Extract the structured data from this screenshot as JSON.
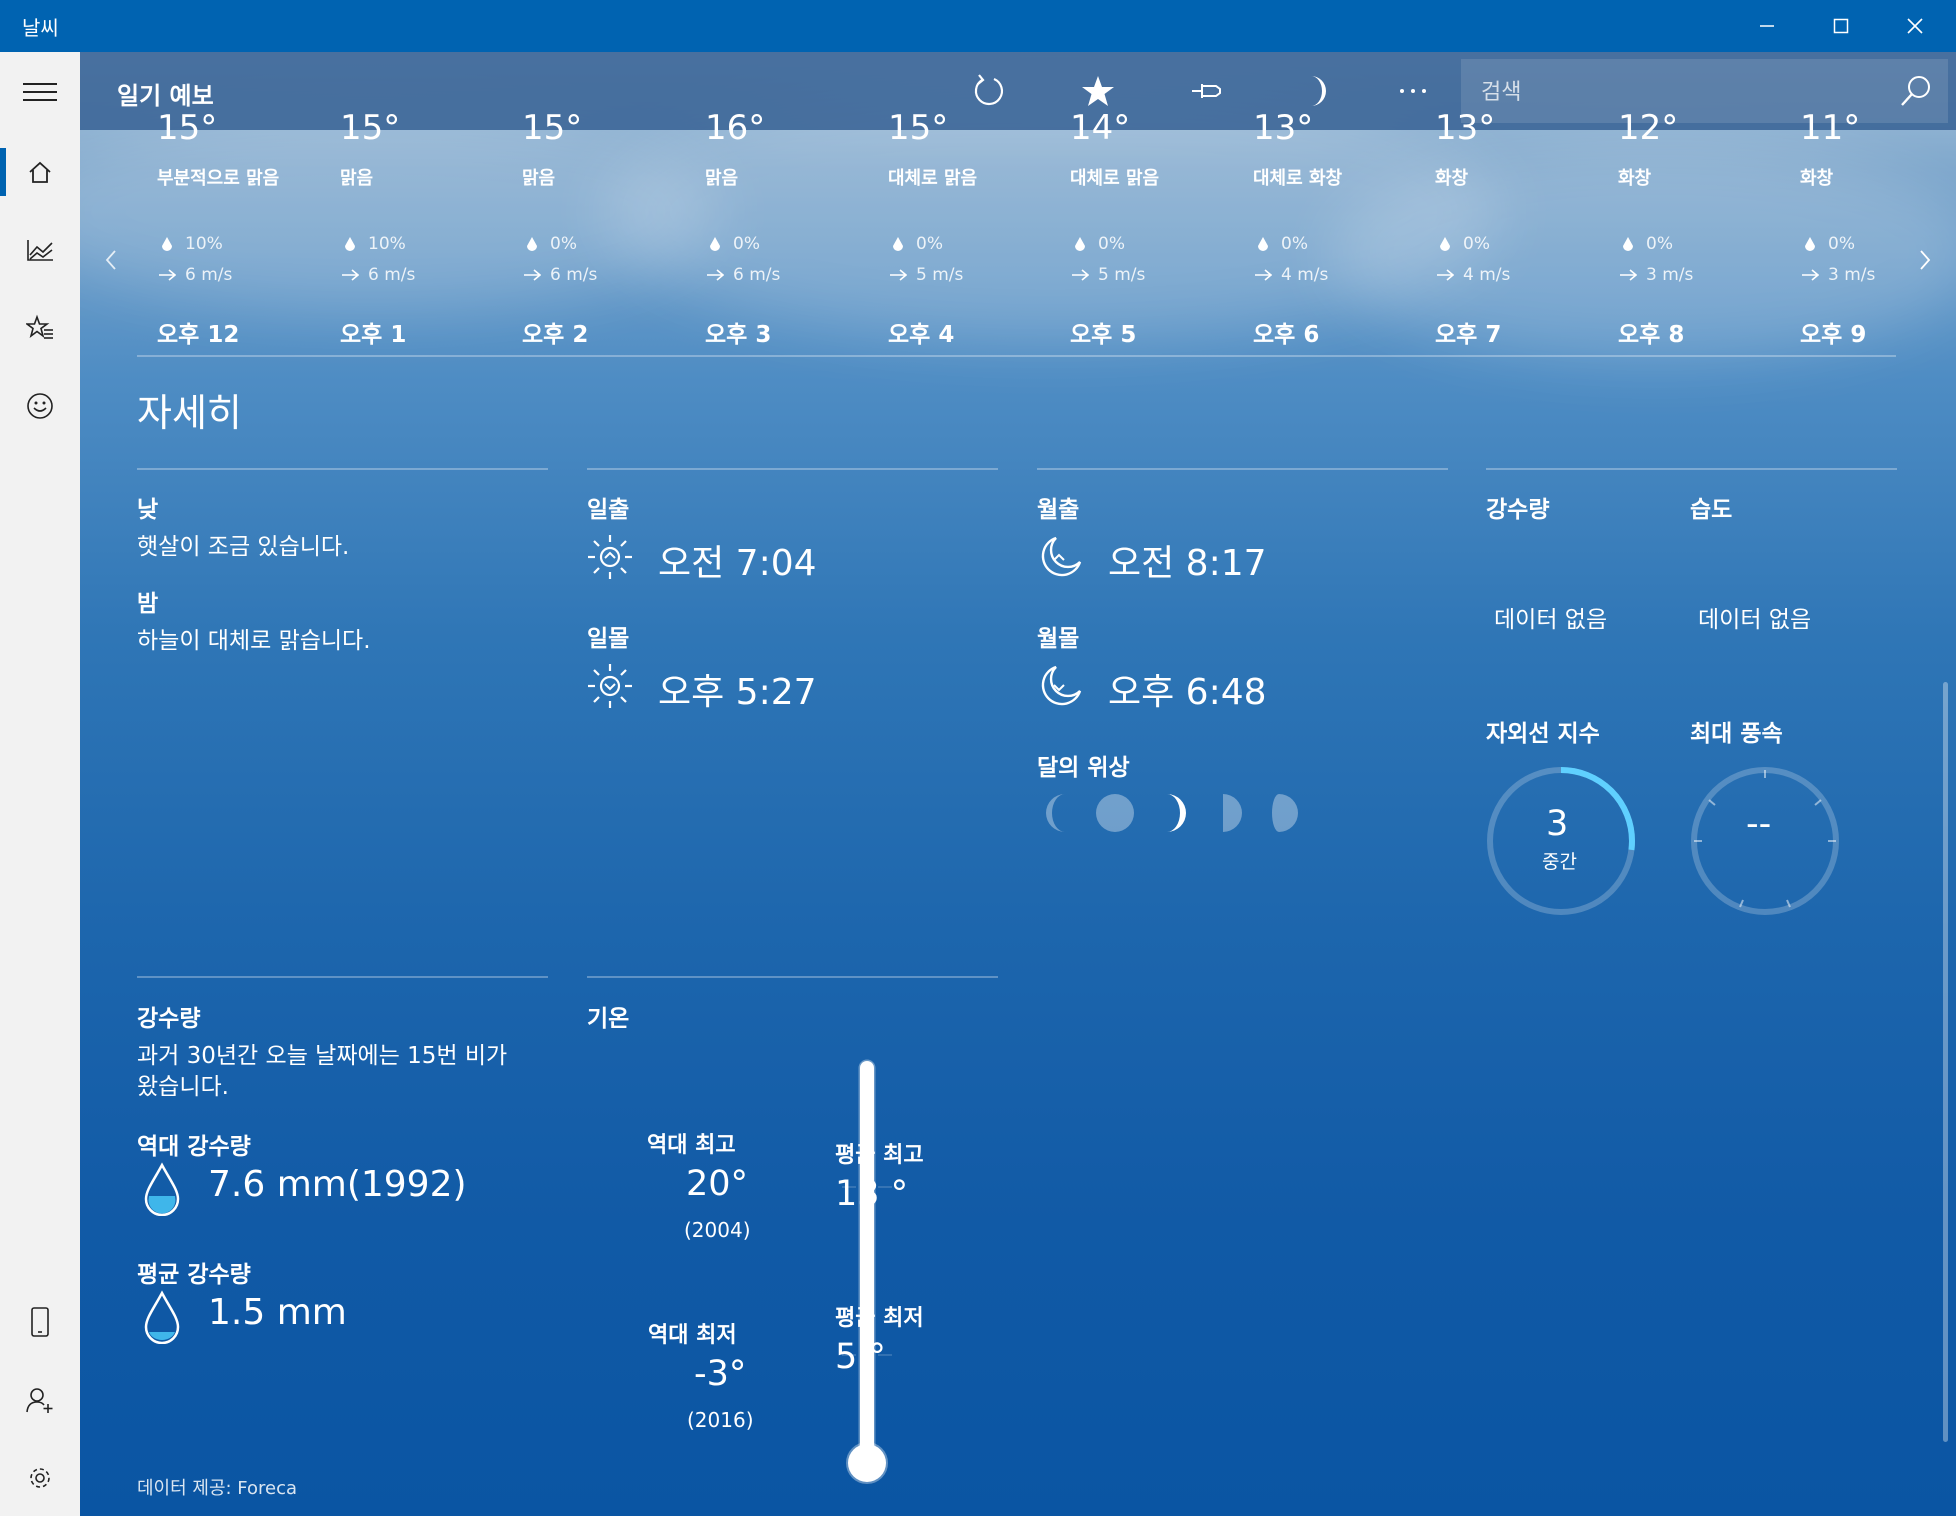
{
  "window": {
    "title": "날씨"
  },
  "header": {
    "title": "일기 예보",
    "search_placeholder": "검색"
  },
  "hourly": [
    {
      "temp": "15°",
      "condition": "부분적으로 맑음",
      "precip": "10%",
      "wind": "6 m/s",
      "time": "오후 12"
    },
    {
      "temp": "15°",
      "condition": "맑음",
      "precip": "10%",
      "wind": "6 m/s",
      "time": "오후 1"
    },
    {
      "temp": "15°",
      "condition": "맑음",
      "precip": "0%",
      "wind": "6 m/s",
      "time": "오후 2"
    },
    {
      "temp": "16°",
      "condition": "맑음",
      "precip": "0%",
      "wind": "6 m/s",
      "time": "오후 3"
    },
    {
      "temp": "15°",
      "condition": "대체로 맑음",
      "precip": "0%",
      "wind": "5 m/s",
      "time": "오후 4"
    },
    {
      "temp": "14°",
      "condition": "대체로 맑음",
      "precip": "0%",
      "wind": "5 m/s",
      "time": "오후 5"
    },
    {
      "temp": "13°",
      "condition": "대체로 화창",
      "precip": "0%",
      "wind": "4 m/s",
      "time": "오후 6"
    },
    {
      "temp": "13°",
      "condition": "화창",
      "precip": "0%",
      "wind": "4 m/s",
      "time": "오후 7"
    },
    {
      "temp": "12°",
      "condition": "화창",
      "precip": "0%",
      "wind": "3 m/s",
      "time": "오후 8"
    },
    {
      "temp": "11°",
      "condition": "화창",
      "precip": "0%",
      "wind": "3 m/s",
      "time": "오후 9"
    }
  ],
  "details": {
    "section_title": "자세히",
    "day_label": "낮",
    "day_text": "햇살이 조금 있습니다.",
    "night_label": "밤",
    "night_text": "하늘이 대체로 맑습니다.",
    "sunrise_label": "일출",
    "sunrise_time": "오전 7:04",
    "sunset_label": "일몰",
    "sunset_time": "오후 5:27",
    "moonrise_label": "월출",
    "moonrise_time": "오전 8:17",
    "moonset_label": "월몰",
    "moonset_time": "오후 6:48",
    "moon_phase_label": "달의 위상",
    "precip_label": "강수량",
    "precip_value": "데이터 없음",
    "humidity_label": "습도",
    "humidity_value": "데이터 없음",
    "uv_label": "자외선 지수",
    "uv_value": "3",
    "uv_level": "중간",
    "uv_fraction": 0.27,
    "wind_label": "최대 풍속",
    "wind_value": "--"
  },
  "history": {
    "precip_title": "강수량",
    "precip_line1": "과거 30년간 오늘 날짜에는 15번 비가",
    "precip_line2": "왔습니다.",
    "record_precip_label": "역대 강수량",
    "record_precip_value": "7.6 mm(1992)",
    "avg_precip_label": "평균 강수량",
    "avg_precip_value": "1.5 mm",
    "temp_title": "기온",
    "record_high_label": "역대 최고",
    "record_high_value": "20°",
    "record_high_year": "(2004)",
    "record_low_label": "역대 최저",
    "record_low_value": "-3°",
    "record_low_year": "(2016)",
    "avg_high_label": "평균 최고",
    "avg_high_value": "13 °",
    "avg_low_label": "평균 최저",
    "avg_low_value": "5 °"
  },
  "footer": {
    "attribution": "데이터 제공: Foreca"
  },
  "colors": {
    "titlebar": "#0063b1",
    "accent_uv": "#5fd0ff",
    "water": "#3fb6ea"
  }
}
